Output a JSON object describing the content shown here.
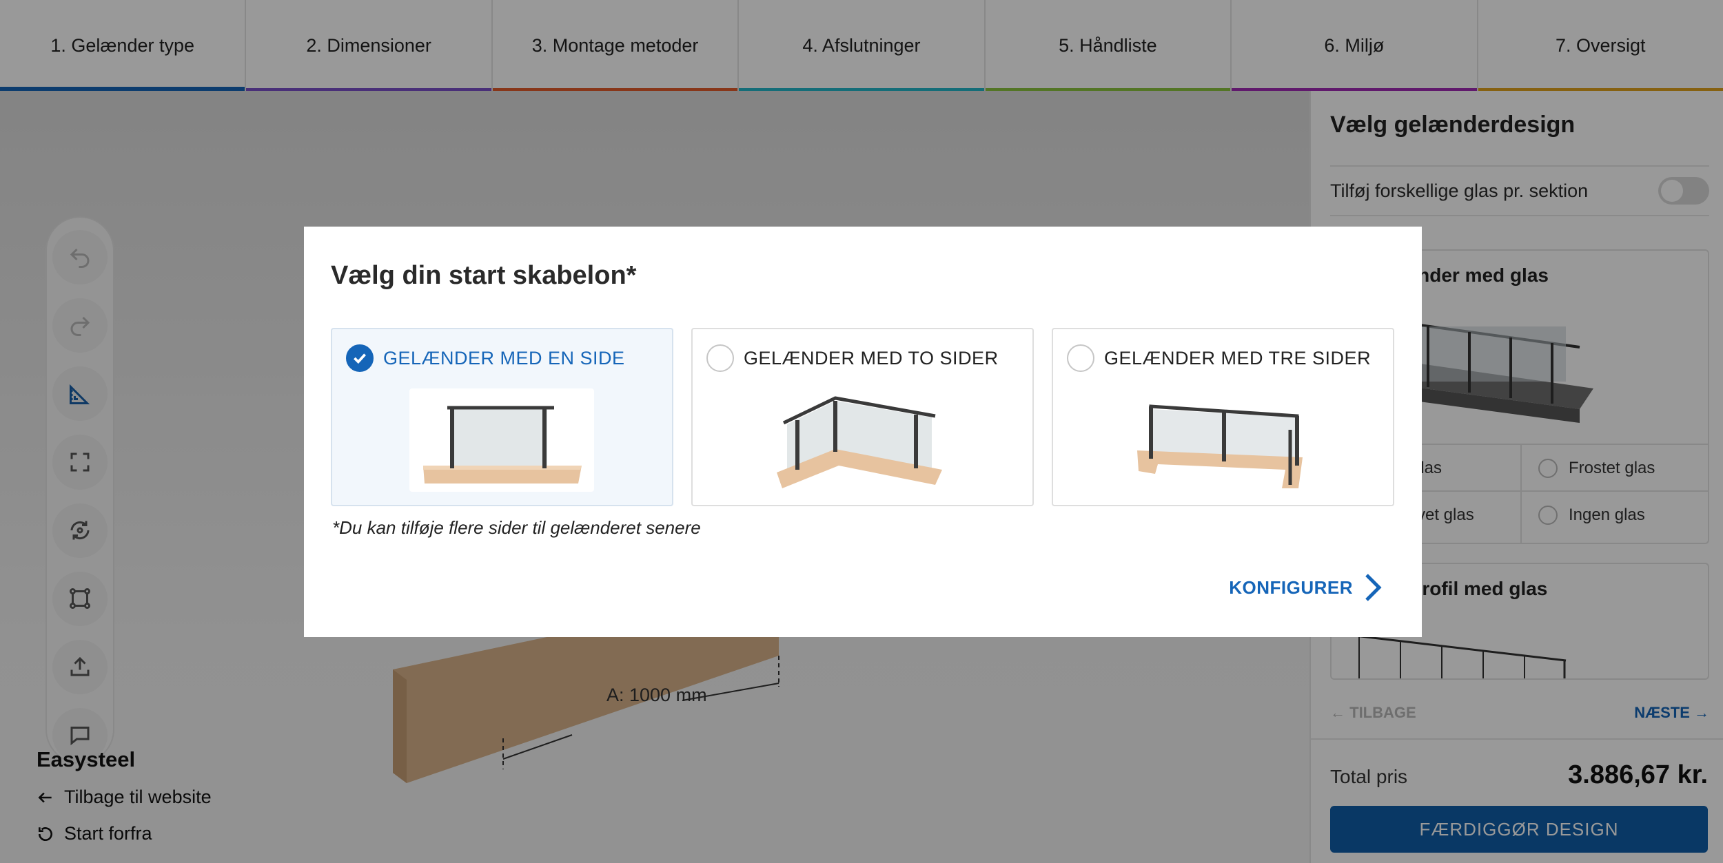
{
  "steps": [
    {
      "label": "1. Gelænder type",
      "color": "#1565b8"
    },
    {
      "label": "2. Dimensioner",
      "color": "#7a4fc9"
    },
    {
      "label": "3. Montage metoder",
      "color": "#e25a2b"
    },
    {
      "label": "4. Afslutninger",
      "color": "#22b6c8"
    },
    {
      "label": "5. Håndliste",
      "color": "#8ac43f"
    },
    {
      "label": "6. Miljø",
      "color": "#a02bb5"
    },
    {
      "label": "7. Oversigt",
      "color": "#e0a21d"
    }
  ],
  "canvas": {
    "dimension_label": "A: 1000 mm",
    "toolbar_icons": [
      "undo-icon",
      "redo-icon",
      "ruler-icon",
      "fullscreen-icon",
      "rotate-view-icon",
      "dimensions-icon",
      "upload-icon",
      "comment-icon"
    ]
  },
  "sidebar_left": {
    "brand": "Easysteel",
    "back_link": "Tilbage til website",
    "restart_link": "Start forfra"
  },
  "panel": {
    "title": "Vælg gelænderdesign",
    "toggle_label": "Tilføj forskellige glas pr. sektion",
    "card1_title": "rit gelænder med glas",
    "card1_options": [
      "glas",
      "Frostet glas",
      "rvet glas",
      "Ingen glas"
    ],
    "card2_title": "iniumsprofil med glas",
    "prev_label": "TILBAGE",
    "next_label": "NÆSTE",
    "total_label": "Total pris",
    "total_value": "3.886,67 kr.",
    "finish_label": "FÆRDIGGØR DESIGN"
  },
  "modal": {
    "title": "Vælg din start skabelon*",
    "options": [
      {
        "label": "GELÆNDER MED EN SIDE",
        "selected": true
      },
      {
        "label": "GELÆNDER MED TO SIDER",
        "selected": false
      },
      {
        "label": "GELÆNDER MED TRE SIDER",
        "selected": false
      }
    ],
    "note": "*Du kan tilføje flere sider til gelænderet senere",
    "configure_label": "KONFIGURER"
  }
}
